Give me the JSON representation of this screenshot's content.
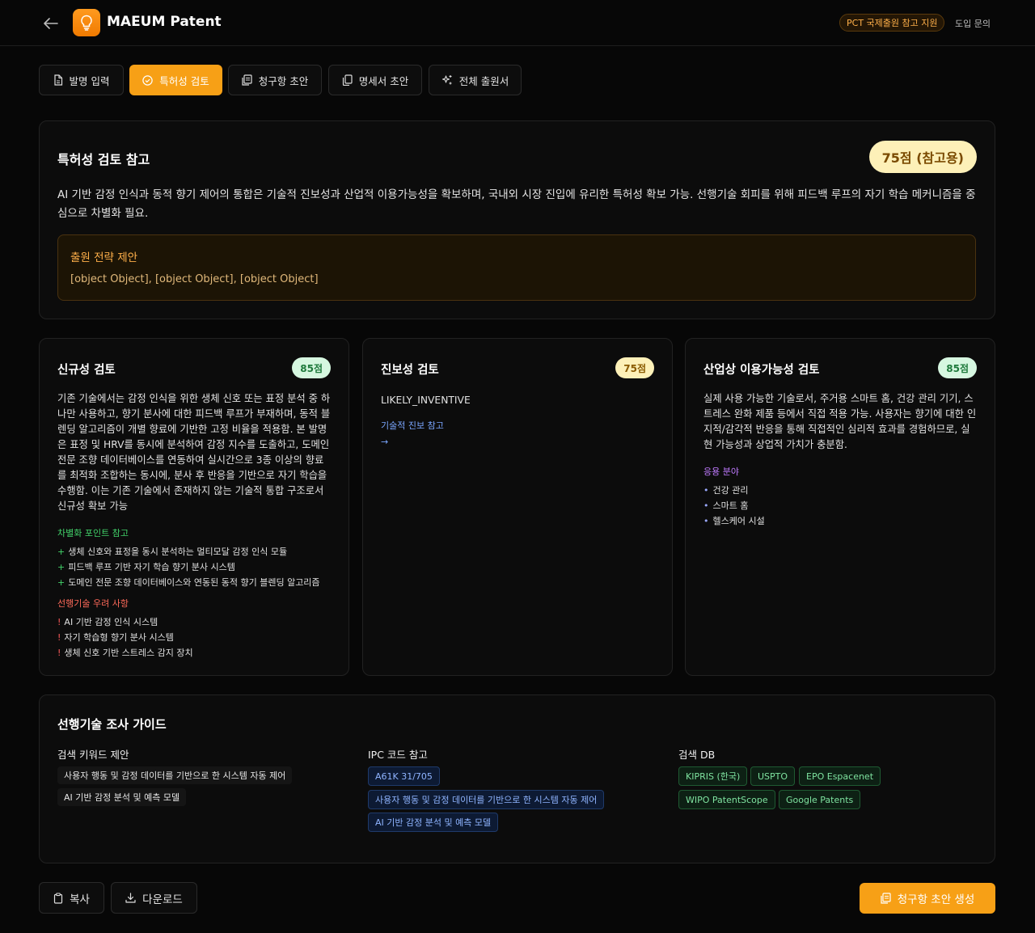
{
  "header": {
    "app_title": "MAEUM Patent",
    "pct_badge": "PCT 국제출원 참고 지원",
    "contact": "도입 문의"
  },
  "tabs": [
    {
      "label": "발명 입력",
      "icon": "document-icon"
    },
    {
      "label": "특허성 검토",
      "icon": "check-circle-icon",
      "active": true
    },
    {
      "label": "청구항 초안",
      "icon": "clipboard-icon"
    },
    {
      "label": "명세서 초안",
      "icon": "copy-icon"
    },
    {
      "label": "전체 출원서",
      "icon": "sparkles-icon"
    }
  ],
  "summary": {
    "title": "특허성 검토 참고",
    "score": "75점 (참고용)",
    "text": "AI 기반 감정 인식과 동적 향기 제어의 통합은 기술적 진보성과 산업적 이용가능성을 확보하며, 국내외 시장 진입에 유리한 특허성 확보 가능. 선행기술 회피를 위해 피드백 루프의 자기 학습 메커니즘을 중심으로 차별화 필요.",
    "strategy_title": "출원 전략 제안",
    "strategy_text": "[object Object], [object Object], [object Object]"
  },
  "novelty": {
    "title": "신규성 검토",
    "score": "85점",
    "body": "기존 기술에서는 감정 인식을 위한 생체 신호 또는 표정 분석 중 하나만 사용하고, 향기 분사에 대한 피드백 루프가 부재하며, 동적 블렌딩 알고리즘이 개별 향료에 기반한 고정 비율을 적용함. 본 발명은 표정 및 HRV를 동시에 분석하여 감정 지수를 도출하고, 도메인 전문 조향 데이터베이스를 연동하여 실시간으로 3종 이상의 향료를 최적화 조합하는 동시에, 분사 후 반응을 기반으로 자기 학습을 수행함. 이는 기존 기술에서 존재하지 않는 기술적 통합 구조로서 신규성 확보 가능",
    "diff_title": "차별화 포인트 참고",
    "diff_points": [
      "생체 신호와 표정을 동시 분석하는 멀티모달 감정 인식 모듈",
      "피드백 루프 기반 자기 학습 향기 분사 시스템",
      "도메인 전문 조향 데이터베이스와 연동된 동적 향기 블렌딩 알고리즘"
    ],
    "concern_title": "선행기술 우려 사항",
    "concerns": [
      "AI 기반 감정 인식 시스템",
      "자기 학습형 향기 분사 시스템",
      "생체 신호 기반 스트레스 감지 장치"
    ]
  },
  "inventive": {
    "title": "진보성 검토",
    "score": "75점",
    "verdict": "LIKELY_INVENTIVE",
    "sub_title": "기술적 진보 참고",
    "arrow": "→"
  },
  "industrial": {
    "title": "산업상 이용가능성 검토",
    "score": "85점",
    "body": "실제 사용 가능한 기술로서, 주거용 스마트 홈, 건강 관리 기기, 스트레스 완화 제품 등에서 직접 적용 가능. 사용자는 향기에 대한 인지적/감각적 반응을 통해 직접적인 심리적 효과를 경험하므로, 실현 가능성과 상업적 가치가 충분함.",
    "fields_title": "응용 분야",
    "fields": [
      "건강 관리",
      "스마트 홈",
      "헬스케어 시설"
    ]
  },
  "prior_art": {
    "title": "선행기술 조사 가이드",
    "keywords_title": "검색 키워드 제안",
    "keywords": [
      "사용자 행동 및 감정 데이터를 기반으로 한 시스템 자동 제어",
      "AI 기반 감정 분석 및 예측 모델"
    ],
    "ipc_title": "IPC 코드 참고",
    "ipc_codes": [
      "A61K 31/705",
      "사용자 행동 및 감정 데이터를 기반으로 한 시스템 자동 제어",
      "AI 기반 감정 분석 및 예측 모델"
    ],
    "db_title": "검색 DB",
    "dbs": [
      "KIPRIS (한국)",
      "USPTO",
      "EPO Espacenet",
      "WIPO PatentScope",
      "Google Patents"
    ]
  },
  "actions": {
    "copy": "복사",
    "download": "다운로드",
    "generate": "청구항 초안 생성"
  },
  "colors": {
    "accent": "#f7a016",
    "background": "#070707",
    "card": "#0c0c0c"
  }
}
